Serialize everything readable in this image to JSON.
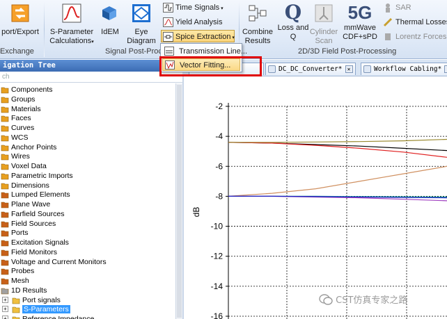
{
  "ribbon": {
    "buttons": {
      "export": "port/Export",
      "sparam_1": "S-Parameter",
      "sparam_2": "Calculations",
      "idem": "IdEM",
      "eye_1": "Eye",
      "eye_2": "Diagram",
      "combine_1": "Combine",
      "combine_2": "Results",
      "loss_1": "Loss and",
      "loss_2": "Q",
      "cyl_1": "Cylinder",
      "cyl_2": "Scan",
      "mmw_1": "mmWave",
      "mmw_2": "CDF+sPD",
      "q_glyph": "Q",
      "fiveg_glyph": "5G"
    },
    "small": {
      "time_signals": "Time Signals",
      "yield_analysis": "Yield Analysis",
      "spice_extraction": "Spice Extraction",
      "sar": "SAR",
      "thermal_losses": "Thermal Losses",
      "lorentz_forces": "Lorentz Forces"
    },
    "groups": {
      "exchange": "Exchange",
      "signal_post": "Signal Post-Proce",
      "field_post": "2D/3D Field Post-Processing"
    }
  },
  "dropdown": {
    "items": [
      "Transmission Line...",
      "Vector Fitting..."
    ]
  },
  "nav": {
    "title": "igation Tree",
    "search": "ch"
  },
  "tabs": [
    "DC_DC_Converter*",
    "Workflow Cabling*"
  ],
  "tree": {
    "items": [
      "Components",
      "Groups",
      "Materials",
      "Faces",
      "Curves",
      "WCS",
      "Anchor Points",
      "Wires",
      "Voxel Data",
      "Parametric Imports",
      "Dimensions",
      "Lumped Elements",
      "Plane Wave",
      "Farfield Sources",
      "Field Sources",
      "Ports",
      "Excitation Signals",
      "Field Monitors",
      "Voltage and Current Monitors",
      "Probes",
      "Mesh",
      "1D Results"
    ],
    "children": [
      "Port signals",
      "S-Parameters",
      "Reference Impedance"
    ]
  },
  "chart_data": {
    "type": "line",
    "ylabel": "dB",
    "ylim": [
      -16,
      -2
    ],
    "yticks": [
      "-2",
      "-4",
      "-6",
      "-8",
      "-10",
      "-12",
      "-14",
      "-16"
    ],
    "series": [
      {
        "color": "#000000",
        "values": [
          -4.4,
          -4.45,
          -4.55,
          -4.65,
          -4.8,
          -4.95
        ]
      },
      {
        "color": "#e02020",
        "values": [
          -4.4,
          -4.45,
          -4.6,
          -4.8,
          -5.05,
          -5.4
        ]
      },
      {
        "color": "#9a8a30",
        "values": [
          -4.4,
          -4.4,
          -4.38,
          -4.35,
          -4.3,
          -4.2
        ]
      },
      {
        "color": "#d09060",
        "values": [
          -8.0,
          -7.8,
          -7.5,
          -7.0,
          -6.5,
          -6.0
        ]
      },
      {
        "color": "#20a0a0",
        "values": [
          -8.0,
          -8.0,
          -8.0,
          -8.02,
          -8.03,
          -8.05
        ]
      },
      {
        "color": "#a040c0",
        "values": [
          -8.0,
          -8.0,
          -8.05,
          -8.1,
          -8.2,
          -8.3
        ]
      },
      {
        "color": "#2020c0",
        "values": [
          -8.0,
          -8.0,
          -8.02,
          -8.05,
          -8.08,
          -8.1
        ]
      }
    ]
  },
  "watermark": "CST仿真专家之路"
}
